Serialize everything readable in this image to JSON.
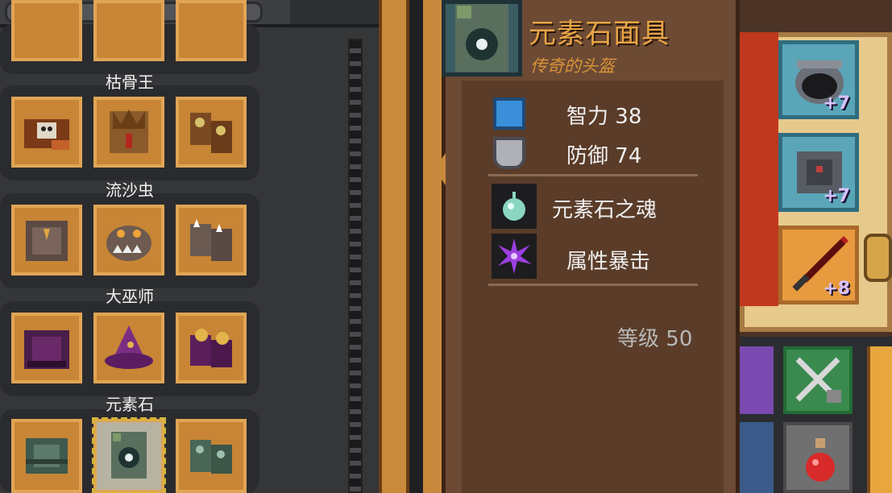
{
  "item": {
    "name": "元素石面具",
    "rarity": "传奇的头盔",
    "stats": [
      {
        "icon": "intelligence-book-icon",
        "label": "智力",
        "value": "38"
      },
      {
        "icon": "defense-shield-icon",
        "label": "防御",
        "value": "74"
      }
    ],
    "effects": [
      {
        "icon": "element-soul-orb-icon",
        "label": "元素石之魂"
      },
      {
        "icon": "purple-crit-burst-icon",
        "label": "属性暴击"
      }
    ],
    "level_label": "等级",
    "level_value": "50"
  },
  "sets": [
    {
      "name": "枯骨王",
      "items": [
        "bone-king-armor-icon",
        "bone-king-helmet-icon",
        "bone-king-boots-icon"
      ]
    },
    {
      "name": "流沙虫",
      "items": [
        "sandworm-armor-icon",
        "sandworm-helmet-icon",
        "sandworm-boots-icon"
      ]
    },
    {
      "name": "大巫师",
      "items": [
        "archmage-robe-icon",
        "archmage-hat-icon",
        "archmage-boots-icon"
      ]
    },
    {
      "name": "元素石",
      "items": [
        "elementstone-armor-icon",
        "elementstone-mask-icon",
        "elementstone-boots-icon"
      ]
    }
  ],
  "equipped": [
    {
      "icon": "helmet-icon",
      "badge": "+7"
    },
    {
      "icon": "chest-armor-icon",
      "badge": "+7"
    },
    {
      "icon": "red-sword-icon",
      "badge": "+8"
    }
  ],
  "bottom_icons": [
    "crossed-swords-locked-icon",
    "red-potion-icon"
  ],
  "colors": {
    "title": "#e8a545",
    "subtitle": "#d89338",
    "slot": "#c78535",
    "equip_slot": "#5aa6b8"
  }
}
